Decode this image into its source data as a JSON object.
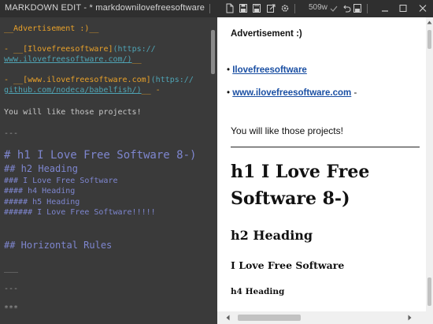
{
  "window": {
    "title": "MARKDOWN EDIT - * markdownilovefreesoftware...",
    "word_count": "509w",
    "icons": [
      "new-file-icon",
      "save-icon",
      "save-as-icon",
      "export-icon",
      "settings-icon",
      "check-icon",
      "undo-icon",
      "save-small-icon"
    ]
  },
  "editor": {
    "advert_heading": "__Advertisement :)__",
    "link1_dash": "- __",
    "link1_text": "[Ilovefreesoftware]",
    "link1_url_a": "(https://",
    "link1_url_b": "www.ilovefreesoftware.com/)",
    "link1_tail": "__",
    "link2_dash": "- __",
    "link2_text": "[www.ilovefreesoftware.com]",
    "link2_url_a": "(https://",
    "link2_url_b": "github.com/nodeca/babelfish/)",
    "link2_tail": "__ -",
    "paragraph": "You will like those projects!",
    "rule1": "---",
    "h1": "# h1 I Love Free Software 8-)",
    "h2": "## h2 Heading",
    "h3": "### I Love Free Software",
    "h4": "#### h4 Heading",
    "h5": "##### h5 Heading",
    "h6": "###### I Love Free Software!!!!!",
    "section": "## Horizontal Rules",
    "rule2": "___",
    "rule3": "---",
    "rule4": "***"
  },
  "preview": {
    "advert_heading": "Advertisement :)",
    "bullet": "•",
    "link1": "Ilovefreesoftware",
    "link2": "www.ilovefreesoftware.com",
    "link2_tail": " -",
    "paragraph": "You will like those projects!",
    "h1_line1": "h1 I Love Free",
    "h1_line2": "Software 8-)",
    "h2": "h2 Heading",
    "h3": "I Love Free Software",
    "h4": "h4 Heading"
  }
}
